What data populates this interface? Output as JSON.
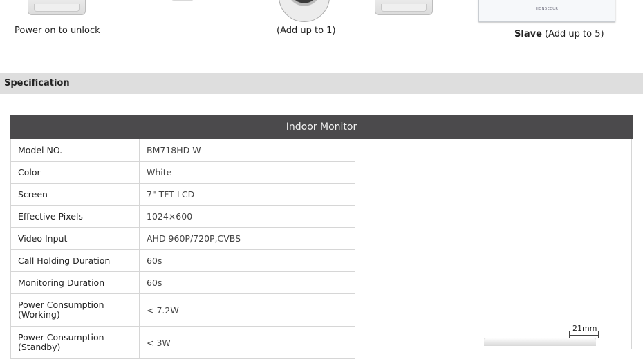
{
  "products": {
    "lock": {
      "caption": "Power on to unlock"
    },
    "camera": {
      "caption": "(Add up to 1)"
    },
    "monitor": {
      "brand": "HONSECUR",
      "caption_bold": "Slave",
      "caption_rest": " (Add up to 5)"
    }
  },
  "section": {
    "title": "Specification"
  },
  "spec_table": {
    "header": "Indoor Monitor",
    "rows": [
      {
        "label": "Model NO.",
        "value": "BM718HD-W"
      },
      {
        "label": "Color",
        "value": "White"
      },
      {
        "label": "Screen",
        "value": "7\" TFT LCD"
      },
      {
        "label": "Effective Pixels",
        "value": "1024×600"
      },
      {
        "label": "Video Input",
        "value": "AHD 960P/720P,CVBS"
      },
      {
        "label": "Call Holding Duration",
        "value": "60s"
      },
      {
        "label": "Monitoring Duration",
        "value": "60s"
      },
      {
        "label": "Power Consumption (Working)",
        "value": "< 7.2W"
      },
      {
        "label": "Power Consumption (Standby)",
        "value": "< 3W"
      }
    ]
  },
  "dimension": {
    "label": "21mm"
  }
}
